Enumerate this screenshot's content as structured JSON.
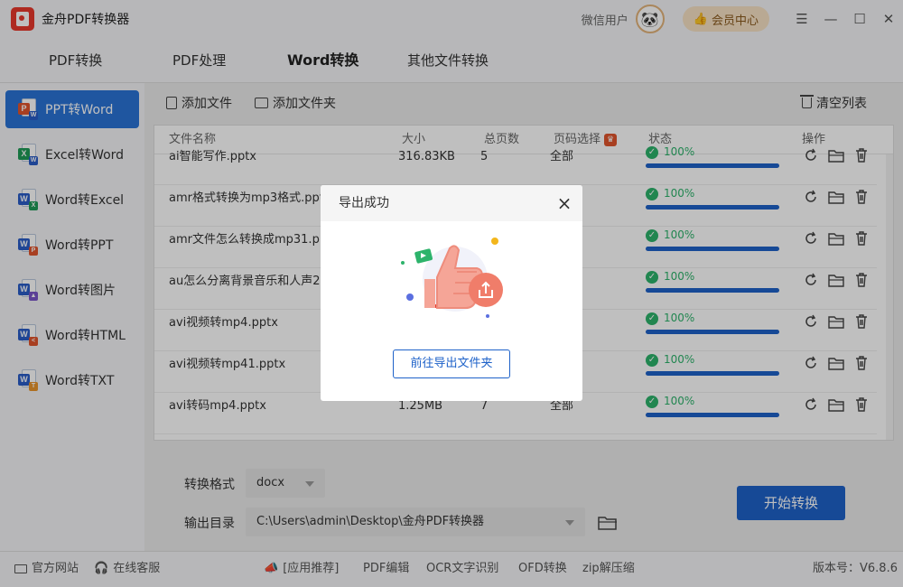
{
  "app": {
    "title": "金舟PDF转换器",
    "user_name": "微信用户",
    "vip_label": "会员中心"
  },
  "tabs": [
    {
      "label": "PDF转换"
    },
    {
      "label": "PDF处理"
    },
    {
      "label": "Word转换"
    },
    {
      "label": "其他文件转换"
    }
  ],
  "active_tab": "Word转换",
  "sidebar": {
    "items": [
      {
        "label": "PPT转Word",
        "icon": "ppt-to-word-icon"
      },
      {
        "label": "Excel转Word",
        "icon": "excel-to-word-icon"
      },
      {
        "label": "Word转Excel",
        "icon": "word-to-excel-icon"
      },
      {
        "label": "Word转PPT",
        "icon": "word-to-ppt-icon"
      },
      {
        "label": "Word转图片",
        "icon": "word-to-image-icon"
      },
      {
        "label": "Word转HTML",
        "icon": "word-to-html-icon"
      },
      {
        "label": "Word转TXT",
        "icon": "word-to-txt-icon"
      }
    ],
    "active": "PPT转Word"
  },
  "toolbar": {
    "add_file": "添加文件",
    "add_folder": "添加文件夹",
    "clear_list": "清空列表"
  },
  "table": {
    "headers": {
      "name": "文件名称",
      "size": "大小",
      "pages": "总页数",
      "page_select": "页码选择",
      "status": "状态",
      "ops": "操作"
    },
    "rows": [
      {
        "name": "ai智能写作.pptx",
        "size": "316.83KB",
        "pages": "5",
        "page_select": "全部",
        "status": "100%",
        "progress": 1.0
      },
      {
        "name": "amr格式转换为mp3格式.pptx",
        "size": "",
        "pages": "",
        "page_select": "",
        "status": "100%",
        "progress": 1.0
      },
      {
        "name": "amr文件怎么转换成mp31.pptx",
        "size": "",
        "pages": "",
        "page_select": "",
        "status": "100%",
        "progress": 1.0
      },
      {
        "name": "au怎么分离背景音乐和人声2.pptx",
        "size": "",
        "pages": "",
        "page_select": "",
        "status": "100%",
        "progress": 1.0
      },
      {
        "name": "avi视频转mp4.pptx",
        "size": "",
        "pages": "",
        "page_select": "",
        "status": "100%",
        "progress": 1.0
      },
      {
        "name": "avi视频转mp41.pptx",
        "size": "",
        "pages": "",
        "page_select": "",
        "status": "100%",
        "progress": 1.0
      },
      {
        "name": "avi转码mp4.pptx",
        "size": "1.25MB",
        "pages": "7",
        "page_select": "全部",
        "status": "100%",
        "progress": 1.0
      }
    ]
  },
  "settings": {
    "format_label": "转换格式",
    "format_value": "docx",
    "output_label": "输出目录",
    "output_value": "C:\\Users\\admin\\Desktop\\金舟PDF转换器",
    "start_button": "开始转换"
  },
  "footer": {
    "website": "官方网站",
    "support": "在线客服",
    "recommend": "[应用推荐]",
    "links": [
      "PDF编辑",
      "OCR文字识别",
      "OFD转换",
      "zip解压缩"
    ],
    "version": "版本号：V6.8.6"
  },
  "modal": {
    "title": "导出成功",
    "button": "前往导出文件夹"
  },
  "colors": {
    "accent": "#1e62c9",
    "sidebar_active": "#2a73d6",
    "success": "#2db36b",
    "modal_icon": "#f07d6a"
  }
}
